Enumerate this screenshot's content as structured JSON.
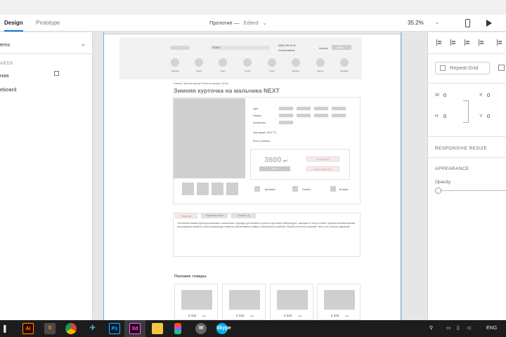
{
  "toolbar": {
    "tab_design": "Design",
    "tab_prototype": "Prototype",
    "doc_title": "Прототип",
    "doc_status": "Edited",
    "zoom": "35.2%"
  },
  "left_panel": {
    "items_label": "ems",
    "section_label": "ARDS",
    "artboard_1": "ная",
    "artboard_2": "eboard"
  },
  "design": {
    "header": {
      "search_label": "ПОИСК",
      "info_line_1": "8(800) 555-35-35",
      "info_line_2": "Личный кабинет",
      "cart_label": "Корзина",
      "login_label": "Войти",
      "categories": [
        "Одежда",
        "Обувь",
        "Игры",
        "Учёба",
        "Спорт",
        "Мебель",
        "Детям",
        "Подарки"
      ]
    },
    "breadcrumbs": "Главная / Детская одежда / Верхняя одежда / Куртки",
    "product_title": "Зимняя курточка на мальчика NEXT",
    "attributes": {
      "color": "Цвет",
      "size": "Размер",
      "qty": "Количество",
      "article": "Код товара: 18 87 78",
      "in_stock": "Есть в наличии"
    },
    "price": "3600",
    "currency": "руб",
    "buy_button": "Купить",
    "wishlist_button": "В избранное",
    "one_click_button": "Купить в один клик",
    "features": [
      "Доставка",
      "Оплата",
      "Возврат"
    ],
    "tabs": [
      "Описание",
      "Характеристики",
      "Отзывы (4)"
    ],
    "description": "Утеплённая зимняя куртка для мальчика с капюшоном. Подходит для активных прогулок при низких температурах, защищает от ветра и влаги. Удобная застёжка-молния, регулируемые манжеты и светоотражающие элементы обеспечивают комфорт и безопасность ребёнка. Легкий утеплитель сохраняет тепло и не стесняет движений.",
    "similar_title": "Похожие товары",
    "similar_prices": [
      "6 345",
      "6 345",
      "6 345",
      "6 345"
    ],
    "similar_currency": "руб"
  },
  "right_panel": {
    "repeat_grid": "Repeat Grid",
    "w_label": "W",
    "w_value": "0",
    "h_label": "H",
    "h_value": "0",
    "x_label": "X",
    "x_value": "0",
    "y_label": "Y",
    "y_value": "0",
    "responsive_resize": "RESPONSIVE RESIZE",
    "appearance": "APPEARANCE",
    "opacity": "Opacity"
  },
  "taskbar": {
    "apps": [
      "Ai",
      "S",
      "Chrome",
      "Sway",
      "Ps",
      "Xd",
      "Explorer",
      "Figma",
      "W",
      "Skype"
    ],
    "language": "ENG"
  },
  "colors": {
    "accent": "#1473e6",
    "guide": "#6ab0e8",
    "taskbar": "#1c1c1c"
  }
}
